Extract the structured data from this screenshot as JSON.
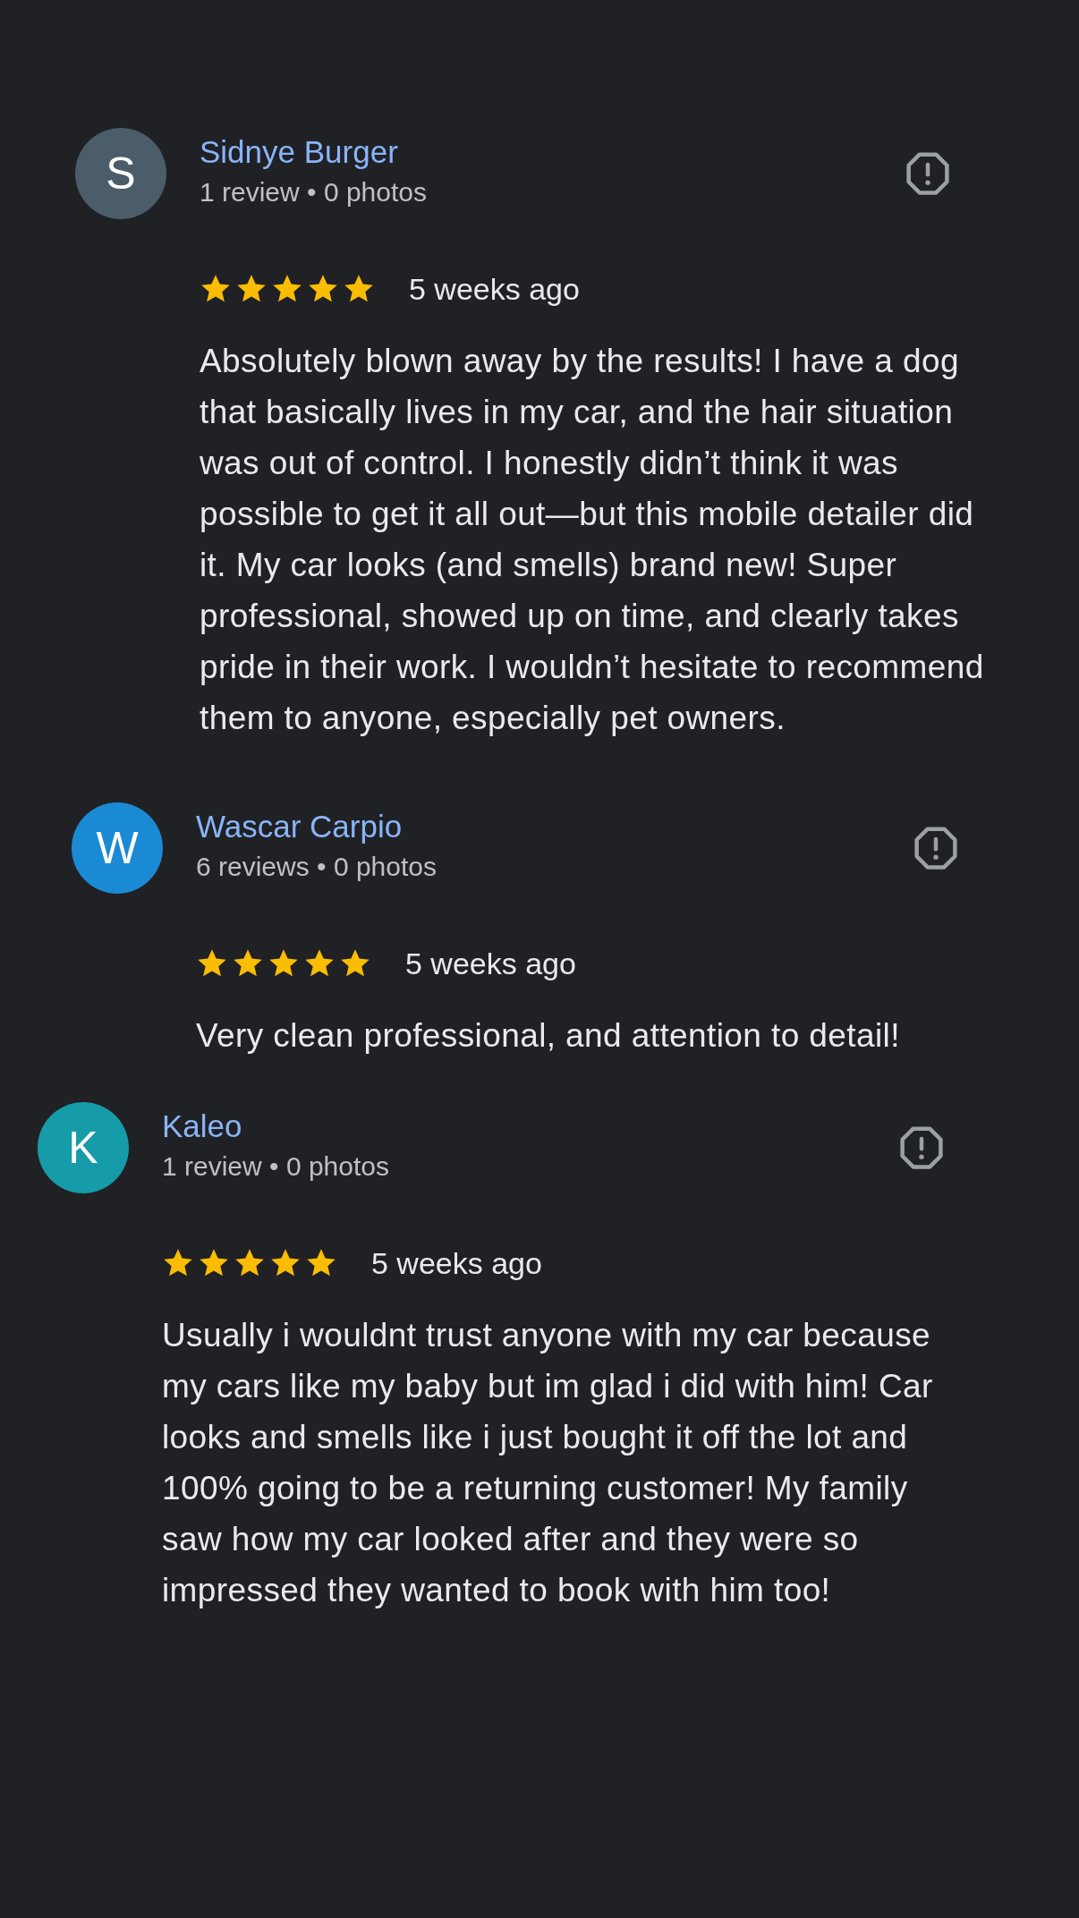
{
  "reviews": [
    {
      "avatar_letter": "S",
      "color": "#4b5d69",
      "name": "Sidnye Burger",
      "meta": "1 review • 0 photos",
      "stars": 5,
      "time": "5 weeks ago",
      "text": "Absolutely blown away by the results! I have a dog that basically lives in my car, and the hair situation was out of control. I honestly didn’t think it was possible to get it all out—but this mobile detailer did it. My car looks (and smells) brand new! Super professional, showed up on time, and clearly takes pride in their work. I wouldn’t hesitate to recommend them to anyone, especially pet owners."
    },
    {
      "avatar_letter": "W",
      "color": "#1a8ad5",
      "name": "Wascar Carpio",
      "meta": "6 reviews • 0 photos",
      "stars": 5,
      "time": "5 weeks ago",
      "text": "Very clean professional, and attention to detail!"
    },
    {
      "avatar_letter": "K",
      "color": "#169ca8",
      "name": "Kaleo",
      "meta": "1 review • 0 photos",
      "stars": 5,
      "time": "5 weeks ago",
      "text": "Usually i wouldnt trust anyone with my car because my cars like my baby but im glad i did with him! Car looks and smells like i just bought it off the lot and 100% going to be a returning customer! My family saw how my car looked after and they were so impressed they wanted to book with him too!"
    }
  ]
}
